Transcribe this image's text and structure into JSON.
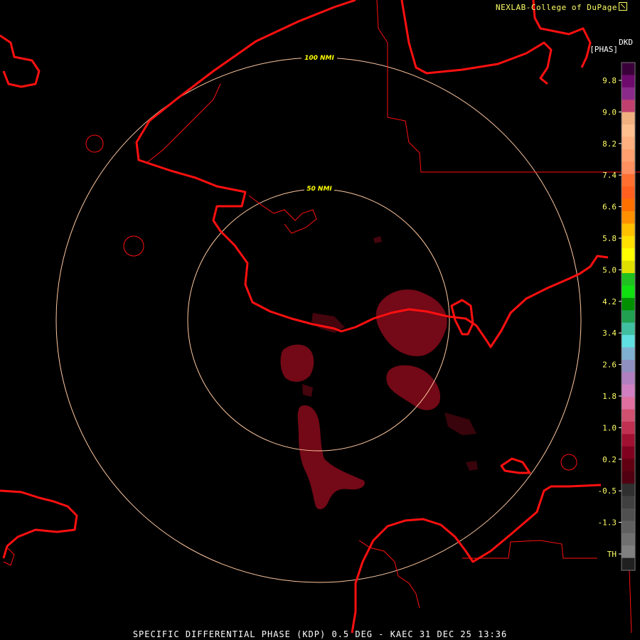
{
  "header": {
    "credit": "NEXLAB-College of DuPage",
    "product_code": "DKD",
    "units": "[PHAS]"
  },
  "footer": {
    "caption": "SPECIFIC DIFFERENTIAL PHASE (KDP) 0.5 DEG - KAEC 31 DEC 25 13:36"
  },
  "range_rings": [
    {
      "label": "50 NMI"
    },
    {
      "label": "100 NMI"
    }
  ],
  "colorbar": {
    "tick_labels": [
      "9.8",
      "9.0",
      "8.2",
      "7.4",
      "6.6",
      "5.8",
      "5.0",
      "4.2",
      "3.4",
      "2.6",
      "1.8",
      "1.0",
      "0.2",
      "-0.5",
      "-1.3",
      "TH"
    ],
    "colors": [
      "#3a003a",
      "#6e0a6e",
      "#8a2a8a",
      "#c04070",
      "#f0b080",
      "#ffc090",
      "#ffb080",
      "#ffa070",
      "#ff9060",
      "#ff7030",
      "#ff6020",
      "#ff7000",
      "#ff9000",
      "#ffc000",
      "#ffe000",
      "#ffff00",
      "#e0e000",
      "#20c020",
      "#10e010",
      "#009000",
      "#20a050",
      "#40c0a0",
      "#60e0e0",
      "#80b0d0",
      "#9090c0",
      "#b080c0",
      "#d080c0",
      "#e070a0",
      "#d05070",
      "#c03050",
      "#a01030",
      "#800020",
      "#600010",
      "#500010",
      "#303030",
      "#404040",
      "#505050",
      "#606060",
      "#707070",
      "#808080",
      "#202020"
    ]
  },
  "map": {
    "border_color": "#ff1010",
    "ring_color": "#ffc8a0",
    "echo_color": "#7a0a18"
  }
}
